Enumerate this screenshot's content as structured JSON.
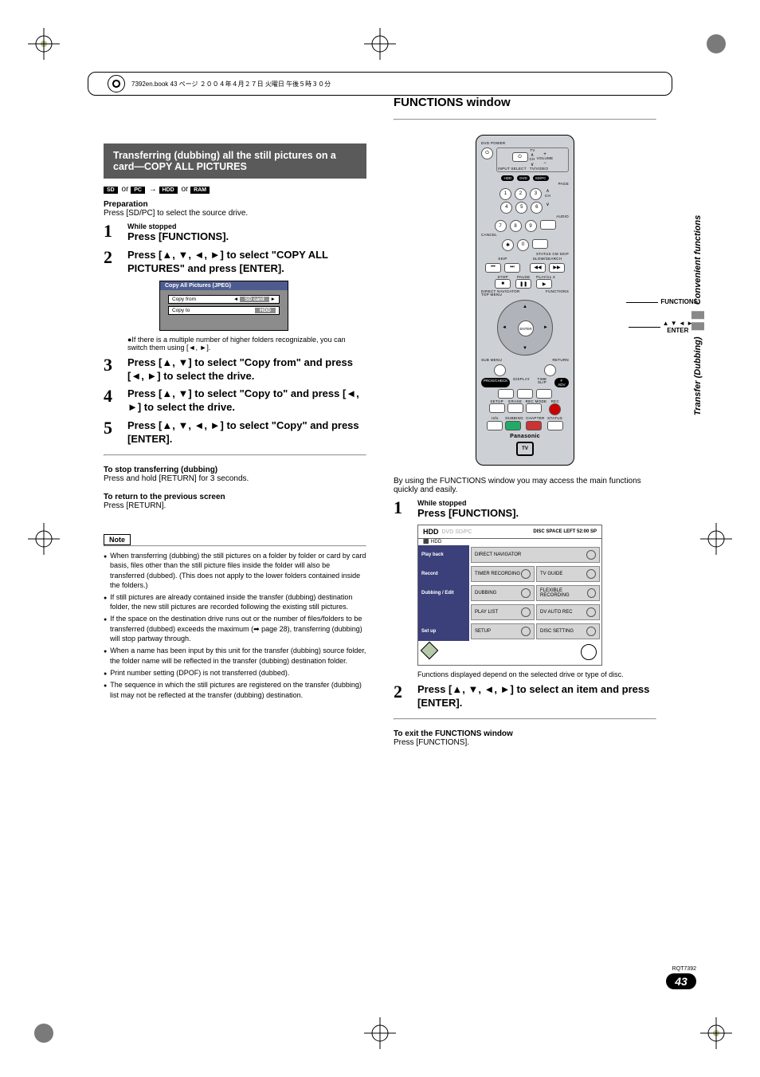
{
  "top_strip": "7392en.book   43 ページ   ２００４年４月２７日   火曜日   午後５時３０分",
  "left": {
    "section_bar": "Transferring (dubbing) all the still pictures on a card—COPY ALL PICTURES",
    "badges": {
      "sd": "SD",
      "or1": "or",
      "pc": "PC",
      "arrow": "→",
      "hdd": "HDD",
      "or2": "or",
      "ram": "RAM"
    },
    "prep_h": "Preparation",
    "prep_p": "Press [SD/PC] to select the source drive.",
    "steps": [
      {
        "n": "1",
        "small": "While stopped",
        "main": "Press [FUNCTIONS]."
      },
      {
        "n": "2",
        "main": "Press [▲, ▼, ◄, ►] to select \"COPY ALL PICTURES\" and press [ENTER]."
      },
      {
        "n": "3",
        "main": "Press [▲, ▼] to select \"Copy from\" and press [◄, ►] to select the drive."
      },
      {
        "n": "4",
        "main": "Press [▲, ▼] to select \"Copy to\" and press [◄, ►] to select the drive."
      },
      {
        "n": "5",
        "main": "Press [▲, ▼, ◄, ►] to select \"Copy\" and press [ENTER]."
      }
    ],
    "copy_box": {
      "header": "Copy All Pictures (JPEG)",
      "row1_lbl": "Copy from",
      "row1_val": "SD card",
      "row2_lbl": "Copy to",
      "row2_val": "HDD"
    },
    "step2_note": "●If there is a multiple number of higher folders recognizable, you can switch them using [◄, ►].",
    "stop_h": "To stop transferring (dubbing)",
    "stop_p": "Press and hold [RETURN] for 3 seconds.",
    "return_h": "To return to the previous screen",
    "return_p": "Press [RETURN].",
    "note_label": "Note",
    "notes": [
      "When transferring (dubbing) the still pictures on a folder by folder or card by card basis, files other than the still picture files inside the folder will also be transferred (dubbed). (This does not apply to the lower folders contained inside the folders.)",
      "If still pictures are already contained inside the transfer (dubbing) destination folder, the new still pictures are recorded following the existing still pictures.",
      "If the space on the destination drive runs out or the number of files/folders to be transferred (dubbed) exceeds the maximum (➡ page 28), transferring (dubbing) will stop partway through.",
      "When a name has been input by this unit for the transfer (dubbing) source folder, the folder name will be reflected in the transfer (dubbing) destination folder.",
      "Print number setting (DPOF) is not transferred (dubbed).",
      "The sequence in which the still pictures are registered on the transfer (dubbing) list may not be reflected at the transfer (dubbing) destination."
    ]
  },
  "right": {
    "title": "FUNCTIONS window",
    "callouts": {
      "functions": "FUNCTIONS",
      "enter": "▲ ▼ ◄ ►\nENTER"
    },
    "remote": {
      "top_lbl": "DVD POWER",
      "tv": "TV",
      "input_select": "INPUT SELECT",
      "tv_video": "TV/VIDEO",
      "ch": "CH",
      "volume": "VOLUME",
      "drives": [
        "HDD",
        "DVD",
        "SD/PC"
      ],
      "page": "PAGE",
      "audio": "AUDIO",
      "cancel": "CANCEL",
      "status_cm": "STATUS  CM SKIP",
      "skip": "SKIP",
      "slow": "SLOW/SEARCH",
      "transport": [
        "STOP",
        "PAUSE",
        "PLAY/x1.3"
      ],
      "direct_nav": "DIRECT NAVIGATOR",
      "functions": "FUNCTIONS",
      "top_menu": "TOP MENU",
      "enter": "ENTER",
      "sub_menu": "SUB MENU",
      "return": "RETURN",
      "prog_check": "PROG/CHECK",
      "display": "DISPLAY",
      "time_slip": "TIME SLIP",
      "f_adv": "F ADV",
      "row1": [
        "SETUP",
        "ERASE",
        "REC MODE",
        "REC"
      ],
      "row2": [
        "Info",
        "DUBBING",
        "CHAPTER",
        "STATUS"
      ],
      "brand": "Panasonic",
      "tv_logo": "TV"
    },
    "intro": "By using the FUNCTIONS window you may access the main functions quickly and easily.",
    "steps": [
      {
        "n": "1",
        "small": "While stopped",
        "main": "Press [FUNCTIONS]."
      },
      {
        "n": "2",
        "main": "Press [▲, ▼, ◄, ►] to select an item and press [ENTER]."
      }
    ],
    "func_table": {
      "hdr_bold": "HDD",
      "hdr_dim": "DVD  SD/PC",
      "hdr_right": "DISC SPACE LEFT   52:00 SP",
      "hdr_sub": "⬛ HDD",
      "rows": [
        {
          "lbl": "Play back",
          "cells": [
            "DIRECT NAVIGATOR"
          ]
        },
        {
          "lbl": "Record",
          "cells": [
            "TIMER RECORDING",
            "TV GUIDE"
          ]
        },
        {
          "lbl": "Dubbing / Edit",
          "cells": [
            "DUBBING",
            "FLEXIBLE RECORDING"
          ]
        },
        {
          "lbl": "",
          "cells": [
            "PLAY LIST",
            "DV AUTO REC"
          ]
        },
        {
          "lbl": "Set up",
          "cells": [
            "SETUP",
            "DISC SETTING"
          ]
        }
      ]
    },
    "caption": "Functions displayed depend on the selected drive or type of disc.",
    "exit_h": "To exit the FUNCTIONS window",
    "exit_p": "Press [FUNCTIONS]."
  },
  "side": {
    "label1": "Transfer (Dubbing)",
    "label2": "Convenient functions"
  },
  "footer": {
    "code": "RQT7392",
    "page": "43"
  }
}
